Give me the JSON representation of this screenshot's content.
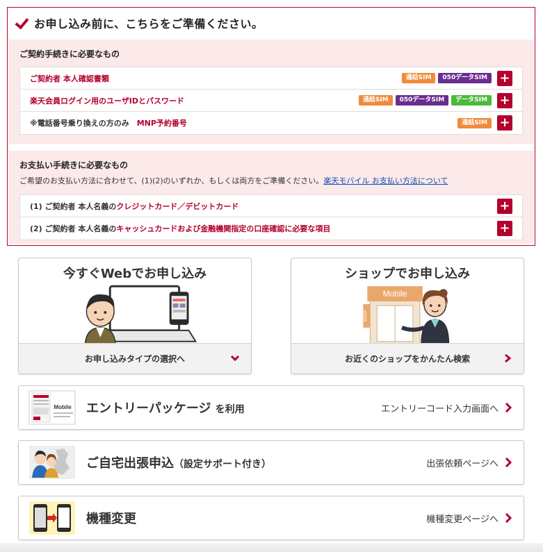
{
  "prep": {
    "title": "お申し込み前に、こちらをご準備ください。",
    "contract": {
      "title": "ご契約手続きに必要なもの",
      "rows": [
        {
          "label_dark": "",
          "label_red": "ご契約者 本人確認書類",
          "badges": [
            "通話SIM",
            "050データSIM"
          ]
        },
        {
          "label_dark": "",
          "label_red": "楽天会員ログイン用のユーザIDとパスワード",
          "badges": [
            "通話SIM",
            "050データSIM",
            "データSIM"
          ]
        },
        {
          "label_dark": "※電話番号乗り換えの方のみ",
          "label_red": "MNP予約番号",
          "badges": [
            "通話SIM"
          ]
        }
      ]
    },
    "payment": {
      "title": "お支払い手続きに必要なもの",
      "note": "ご希望のお支払い方法に合わせて、(1)(2)のいずれか、もしくは両方をご準備ください。",
      "note_link": "楽天モバイル お支払い方法について",
      "rows": [
        {
          "label_dark": "(1) ご契約者 本人名義の",
          "label_red": "クレジットカード／デビットカード"
        },
        {
          "label_dark": "(2) ご契約者 本人名義の",
          "label_red": "キャッシュカードおよび金融機関指定の口座確認に必要な項目"
        }
      ]
    },
    "plus_symbol": "+"
  },
  "cards": {
    "web": {
      "title": "今すぐWebでお申し込み",
      "footer": "お申し込みタイプの選択へ"
    },
    "shop": {
      "title": "ショップでお申し込み",
      "footer": "お近くのショップをかんたん検索",
      "sign": "Mobile",
      "shop_sign": "SHOP"
    }
  },
  "bars": {
    "entry": {
      "title": "エントリーパッケージ",
      "title_suffix": "を利用",
      "link": "エントリーコード入力画面へ",
      "thumb_text": "Mobile"
    },
    "home": {
      "title": "ご自宅出張申込",
      "title_suffix": "（設定サポート付き）",
      "link": "出張依頼ページへ"
    },
    "device": {
      "title": "機種変更",
      "link": "機種変更ページへ"
    }
  },
  "colors": {
    "brand": "#b3002d",
    "talk_sim": "#f08b3c",
    "data050_sim": "#6a2d8f",
    "data_sim": "#4cba3f",
    "section_bg": "#fce9ea"
  }
}
